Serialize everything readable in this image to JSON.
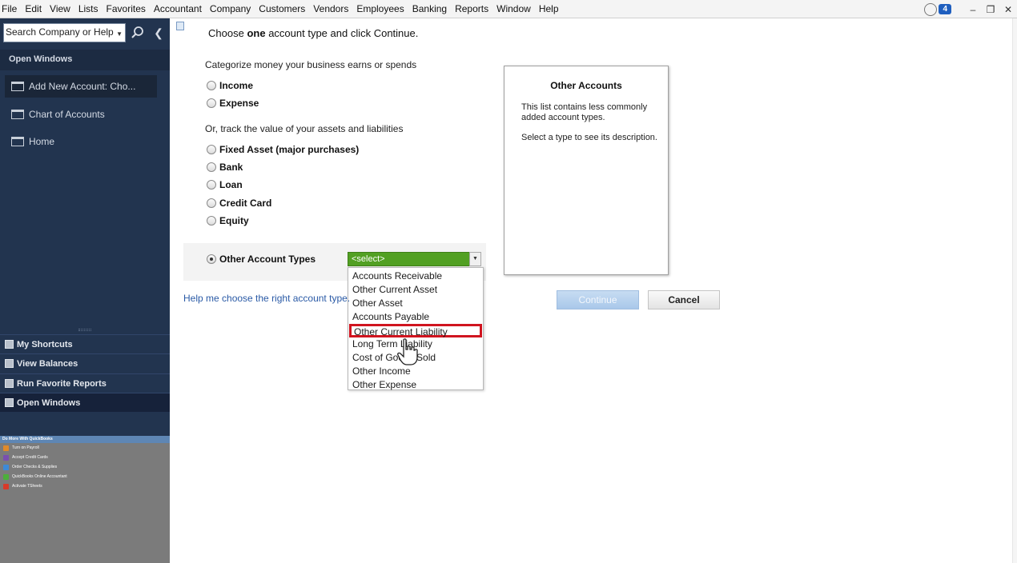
{
  "menubar": {
    "items": [
      "File",
      "Edit",
      "View",
      "Lists",
      "Favorites",
      "Accountant",
      "Company",
      "Customers",
      "Vendors",
      "Employees",
      "Banking",
      "Reports",
      "Window",
      "Help"
    ],
    "notification_count": "4"
  },
  "sidebar": {
    "search_placeholder": "Search Company or Help",
    "open_windows_header": "Open Windows",
    "open_windows": [
      "Add New Account: Cho...",
      "Chart of Accounts",
      "Home"
    ],
    "shortcuts": [
      "My Shortcuts",
      "View Balances",
      "Run Favorite Reports",
      "Open Windows"
    ],
    "promo": {
      "title": "Do More With QuickBooks",
      "items": [
        "Turn on Payroll",
        "Accept Credit Cards",
        "Order Checks & Supplies",
        "QuickBooks Online Accountant",
        "Activate TSheets"
      ],
      "colors": [
        "#e08a2a",
        "#7a4fb0",
        "#3d8ad8",
        "#4caf3a",
        "#d83a2a"
      ]
    }
  },
  "main": {
    "heading_pre": "Choose",
    "heading_bold": "one",
    "heading_post": "account type and click Continue.",
    "categorize_label": "Categorize money your business earns or spends",
    "track_label": "Or, track the value of your assets and liabilities",
    "radio_income": "Income",
    "radio_expense": "Expense",
    "radio_fixed_asset": "Fixed Asset (major purchases)",
    "radio_bank": "Bank",
    "radio_loan": "Loan",
    "radio_credit_card": "Credit Card",
    "radio_equity": "Equity",
    "radio_other": "Other Account Types",
    "select_value": "<select>",
    "dropdown_options": [
      "Accounts Receivable",
      "Other Current Asset",
      "Other Asset",
      "Accounts Payable",
      "Other Current Liability",
      "Long Term Liability",
      "Cost of Goods Sold",
      "Other Income",
      "Other Expense"
    ],
    "highlighted_option": "Other Current Liability",
    "help_link": "Help me choose the right account type.",
    "desc_title": "Other Accounts",
    "desc_text1": "This list contains less commonly added account types.",
    "desc_text2": "Select a type to see its description.",
    "continue_label": "Continue",
    "cancel_label": "Cancel"
  }
}
